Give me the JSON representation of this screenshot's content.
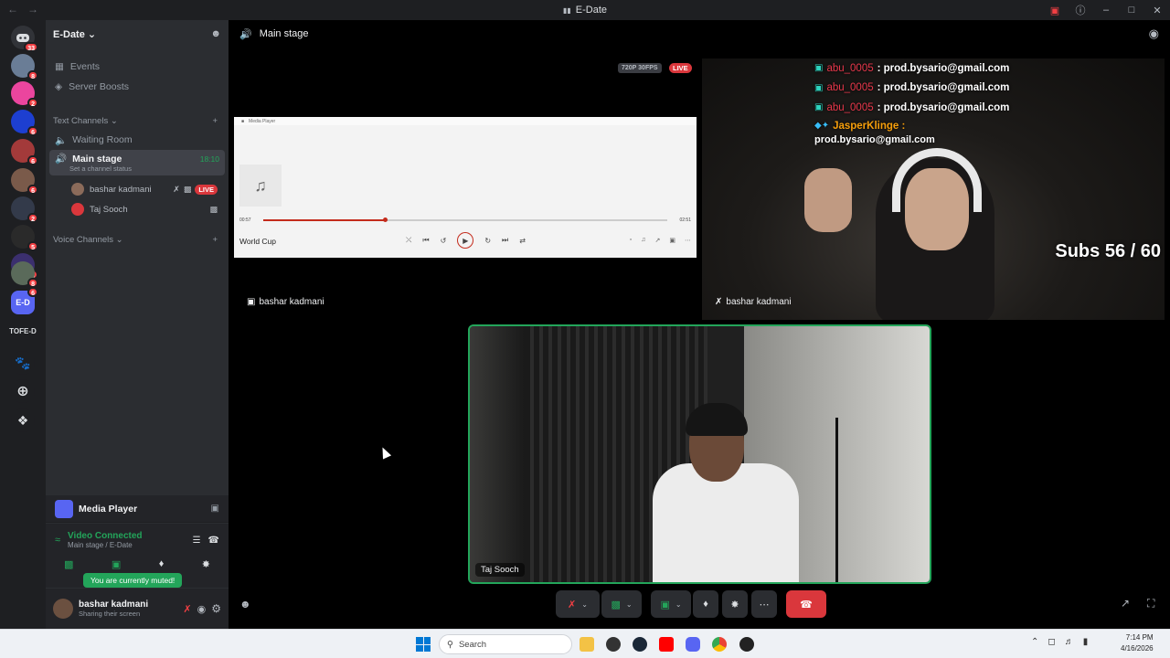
{
  "window": {
    "title": "E-Date"
  },
  "rail": {
    "badges": [
      "33",
      "8",
      "2",
      "6",
      "6",
      "6",
      "2",
      "5",
      "6",
      "8",
      "6"
    ],
    "tofe_label": "TOFE-D",
    "edate_label": "E-D"
  },
  "server": {
    "name": "E-Date",
    "events_label": "Events",
    "boosts_label": "Server Boosts",
    "text_category": "Text Channels",
    "voice_category": "Voice Channels",
    "channels": [
      {
        "name": "Waiting Room"
      },
      {
        "name": "Main stage",
        "time": "18:10",
        "status_placeholder": "Set a channel status"
      }
    ],
    "voice_users": [
      {
        "name": "bashar kadmani",
        "live": "LIVE"
      },
      {
        "name": "Taj Sooch"
      }
    ]
  },
  "activity": {
    "title": "Media Player",
    "connection_status": "Video Connected",
    "connection_location": "Main stage / E-Date",
    "muted_tooltip": "You are currently muted!"
  },
  "user": {
    "name": "bashar kadmani",
    "status": "Sharing their screen"
  },
  "stage": {
    "header": "Main stage",
    "stream_quality": "720P 30FPS",
    "live": "LIVE",
    "tile1_label": "bashar kadmani",
    "tile2_label": "bashar kadmani",
    "tile3_label": "Taj Sooch",
    "media_player": {
      "window_title": "Media Player",
      "track": "World Cup",
      "elapsed": "00:57",
      "total": "02:51",
      "progress": 0.3
    },
    "chat": [
      {
        "user": "abu_0005",
        "msg": ": prod.bysario@gmail.com"
      },
      {
        "user": "abu_0005",
        "msg": ": prod.bysario@gmail.com"
      },
      {
        "user": "abu_0005",
        "msg": ": prod.bysario@gmail.com"
      }
    ],
    "chat_last_user": "JasperKlinge :",
    "chat_last_msg": "prod.bysario@gmail.com",
    "subs_overlay": "Subs 56 / 60"
  },
  "taskbar": {
    "search_placeholder": "Search",
    "time": "7:14 PM",
    "date": "4/16/2026"
  },
  "colors": {
    "green": "#23a55a",
    "red": "#da373c",
    "blurple": "#5865f2"
  }
}
